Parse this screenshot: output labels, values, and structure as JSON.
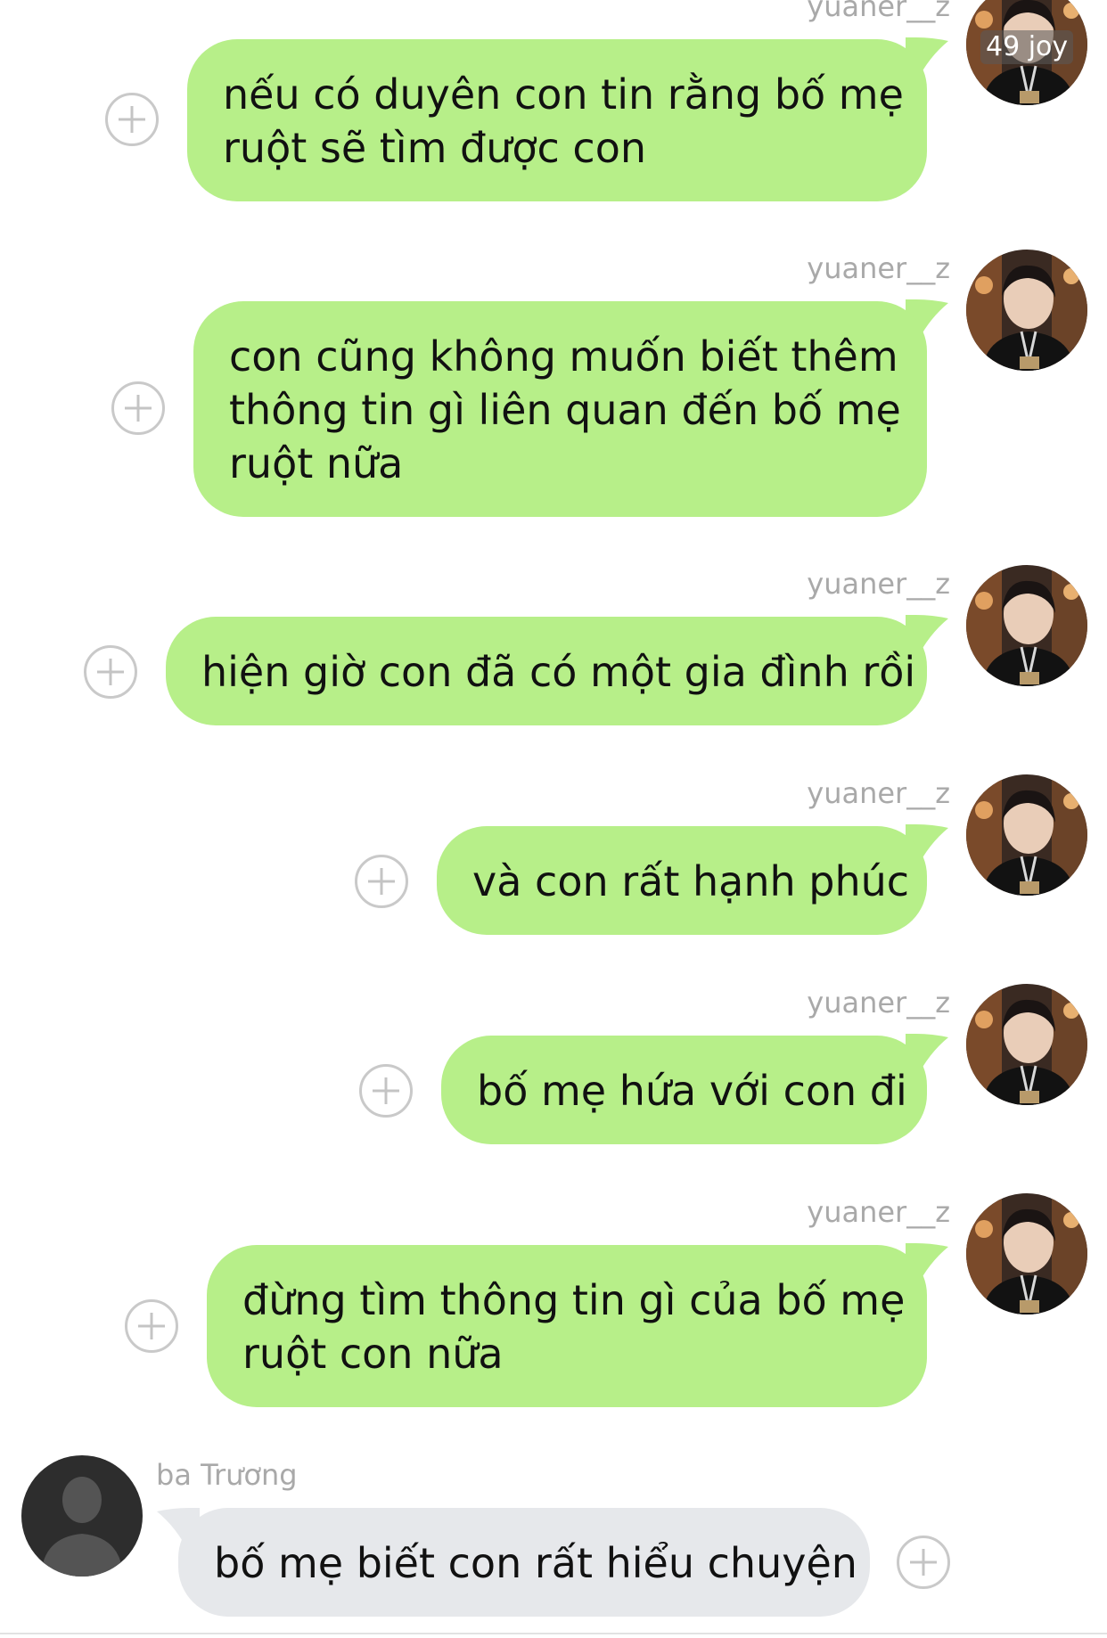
{
  "badge": "49 joy",
  "colors": {
    "outgoing_bubble": "#b7ef89",
    "incoming_bubble": "#e6e8eb",
    "sender_name": "#a9a9a9"
  },
  "messages": [
    {
      "sender": "yuaner__z",
      "direction": "outgoing",
      "lines": [
        "nếu có duyên con tin rằng bố mẹ",
        "ruột sẽ tìm được con"
      ]
    },
    {
      "sender": "yuaner__z",
      "direction": "outgoing",
      "lines": [
        "con cũng không muốn biết thêm",
        "thông tin gì liên quan đến bố mẹ",
        "ruột nữa"
      ]
    },
    {
      "sender": "yuaner__z",
      "direction": "outgoing",
      "lines": [
        "hiện giờ con đã có một gia đình rồi"
      ]
    },
    {
      "sender": "yuaner__z",
      "direction": "outgoing",
      "lines": [
        "và con rất hạnh phúc"
      ]
    },
    {
      "sender": "yuaner__z",
      "direction": "outgoing",
      "lines": [
        "bố mẹ hứa với con đi"
      ]
    },
    {
      "sender": "yuaner__z",
      "direction": "outgoing",
      "lines": [
        "đừng tìm thông tin gì của bố mẹ",
        "ruột con nữa"
      ]
    },
    {
      "sender": "ba Trương",
      "direction": "incoming",
      "lines": [
        "bố mẹ biết con rất hiểu chuyện"
      ]
    }
  ],
  "icons": {
    "add_reaction": "plus-circle-icon",
    "user_avatar": "avatar-photo",
    "contact_avatar": "default-person-silhouette"
  }
}
